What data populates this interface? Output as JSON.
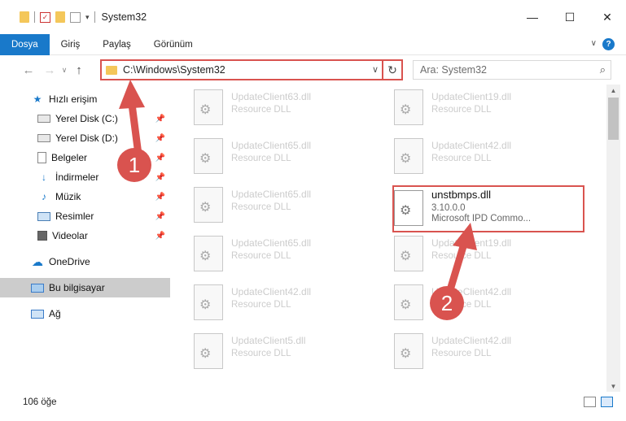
{
  "window": {
    "title": "System32",
    "controls": [
      "—",
      "☐",
      "✕"
    ]
  },
  "ribbon": {
    "tabs": [
      "Dosya",
      "Giriş",
      "Paylaş",
      "Görünüm"
    ],
    "active_tab": "Dosya"
  },
  "navigation": {
    "address": "C:\\Windows\\System32",
    "search_placeholder": "Ara: System32"
  },
  "sidebar": {
    "quick_access": "Hızlı erişim",
    "items": [
      {
        "label": "Yerel Disk (C:)",
        "icon": "drive-icon",
        "pinned": true
      },
      {
        "label": "Yerel Disk (D:)",
        "icon": "drive-icon",
        "pinned": true
      },
      {
        "label": "Belgeler",
        "icon": "documents-icon",
        "pinned": true
      },
      {
        "label": "İndirmeler",
        "icon": "downloads-icon",
        "pinned": true
      },
      {
        "label": "Müzik",
        "icon": "music-icon",
        "pinned": true
      },
      {
        "label": "Resimler",
        "icon": "pictures-icon",
        "pinned": true
      },
      {
        "label": "Videolar",
        "icon": "videos-icon",
        "pinned": true
      }
    ],
    "onedrive": "OneDrive",
    "this_pc": "Bu bilgisayar",
    "network": "Ağ"
  },
  "files": {
    "left_column": [
      {
        "name": "UpdateClient63.dll",
        "desc": "Resource DLL"
      },
      {
        "name": "UpdateClient65.dll",
        "desc": "Resource DLL"
      },
      {
        "name": "UpdateClient65.dll",
        "desc": "Resource DLL"
      },
      {
        "name": "UpdateClient65.dll",
        "desc": "Resource DLL"
      },
      {
        "name": "UpdateClient42.dll",
        "desc": "Resource DLL"
      },
      {
        "name": "UpdateClient5.dll",
        "desc": "Resource DLL"
      }
    ],
    "right_column": [
      {
        "name": "UpdateClient19.dll",
        "desc": "Resource DLL"
      },
      {
        "name": "UpdateClient42.dll",
        "desc": "Resource DLL"
      },
      {
        "name": "unstbmps.dll",
        "version": "3.10.0.0",
        "desc": "Microsoft IPD Commo..."
      },
      {
        "name": "UpdateClient19.dll",
        "desc": "Resource DLL"
      },
      {
        "name": "UpdateClient42.dll",
        "desc": "Resource DLL"
      },
      {
        "name": "UpdateClient42.dll",
        "desc": "Resource DLL"
      }
    ]
  },
  "status": {
    "item_count": "106 öğe"
  },
  "annotations": {
    "step1": "1",
    "step2": "2",
    "color": "#d9534f"
  }
}
